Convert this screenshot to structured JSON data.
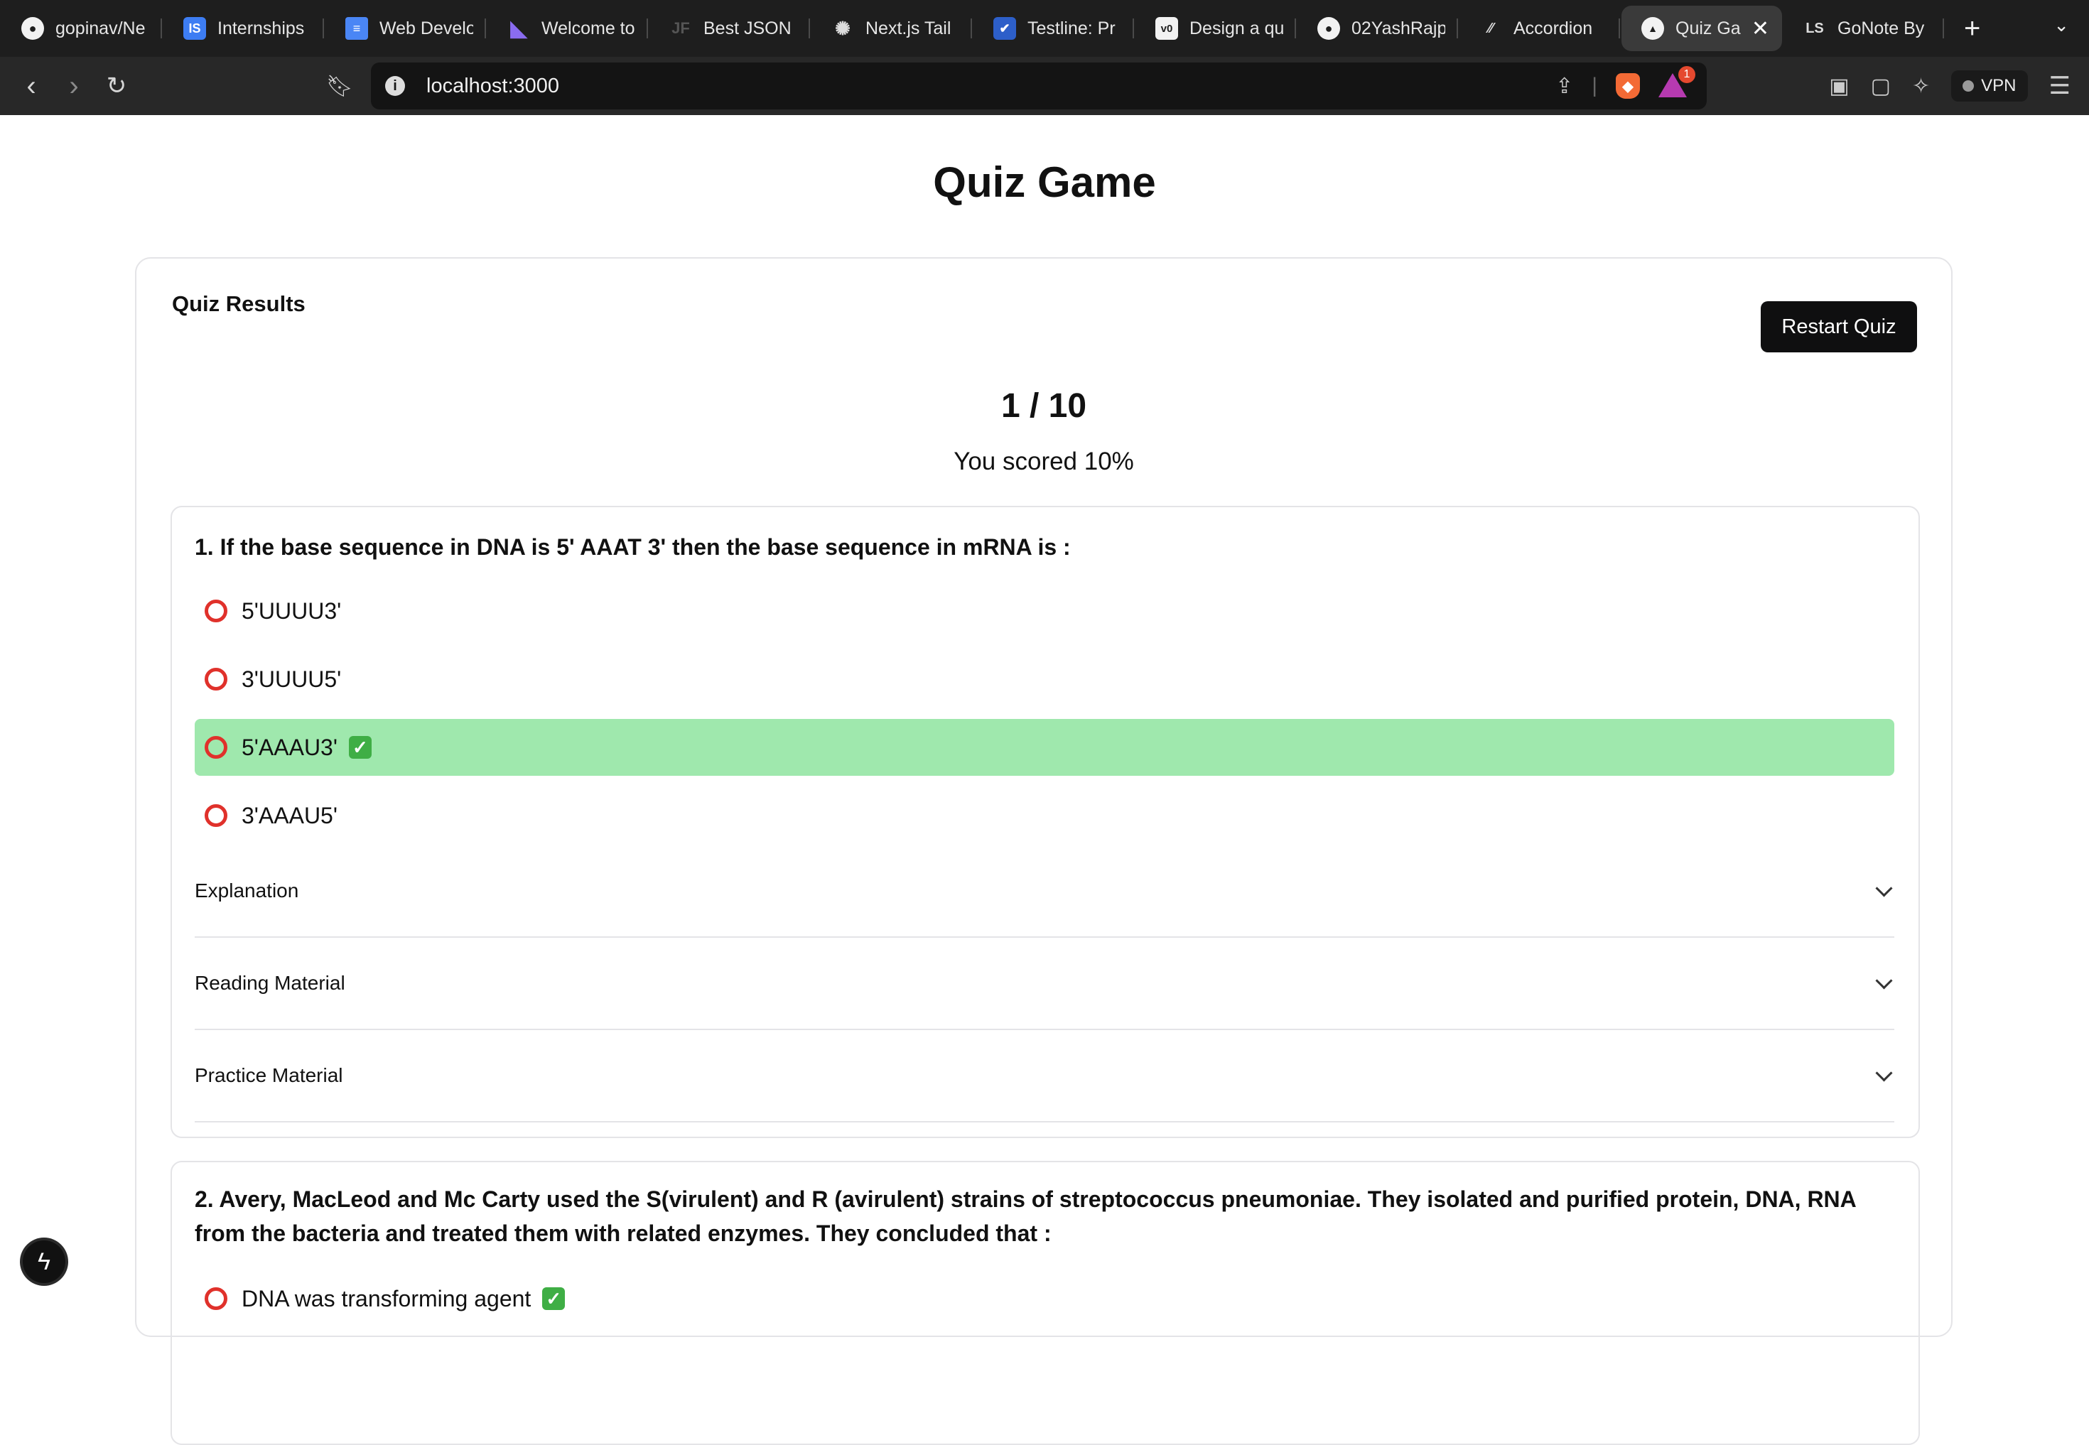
{
  "browser": {
    "tabs": [
      {
        "label": "gopinav/Ne",
        "icon": "github-icon",
        "glyph": "●"
      },
      {
        "label": "Internships",
        "icon": "internshala-icon",
        "glyph": "IS"
      },
      {
        "label": "Web Develo",
        "icon": "google-docs-icon",
        "glyph": "≡"
      },
      {
        "label": "Welcome to",
        "icon": "linear-icon",
        "glyph": "◣"
      },
      {
        "label": "Best JSON",
        "icon": "jsonformatter-icon",
        "glyph": "JF"
      },
      {
        "label": "Next.js Tail",
        "icon": "chatgpt-icon",
        "glyph": "✺"
      },
      {
        "label": "Testline: Pr",
        "icon": "testline-icon",
        "glyph": "✔"
      },
      {
        "label": "Design a qu",
        "icon": "v0-icon",
        "glyph": "v0"
      },
      {
        "label": "02YashRajp",
        "icon": "github-icon",
        "glyph": "●"
      },
      {
        "label": "Accordion",
        "icon": "shadcn-icon",
        "glyph": "⁄⁄"
      },
      {
        "label": "Quiz Ga",
        "icon": "vercel-icon",
        "glyph": "▲",
        "active": true
      },
      {
        "label": "GoNote By",
        "icon": "gonote-icon",
        "glyph": "LS"
      }
    ],
    "new_tab": "+",
    "url": "localhost:3000",
    "rewards_badge": "1",
    "vpn_label": "VPN"
  },
  "page": {
    "title": "Quiz Game",
    "results_heading": "Quiz Results",
    "restart_label": "Restart Quiz",
    "score": "1 / 10",
    "score_text": "You scored 10%"
  },
  "questions": [
    {
      "text": "1. If the base sequence in DNA is 5' AAAT 3' then the base sequence in mRNA is :",
      "options": [
        "5'UUUU3'",
        "3'UUUU5'",
        "5'AAAU3'",
        "3'AAAU5'"
      ],
      "correct_index": 2,
      "accordions": [
        "Explanation",
        "Reading Material",
        "Practice Material"
      ]
    },
    {
      "text": "2. Avery, MacLeod and Mc Carty used the S(virulent) and R (avirulent) strains of streptococcus pneumoniae. They isolated and purified protein, DNA, RNA from the bacteria and treated them with related enzymes. They concluded that :",
      "options": [
        "DNA was transforming agent"
      ],
      "correct_index": 0
    }
  ],
  "colors": {
    "correct_bg": "#9fe8ad",
    "radio": "#e0312b",
    "button_bg": "#0f0f10"
  }
}
